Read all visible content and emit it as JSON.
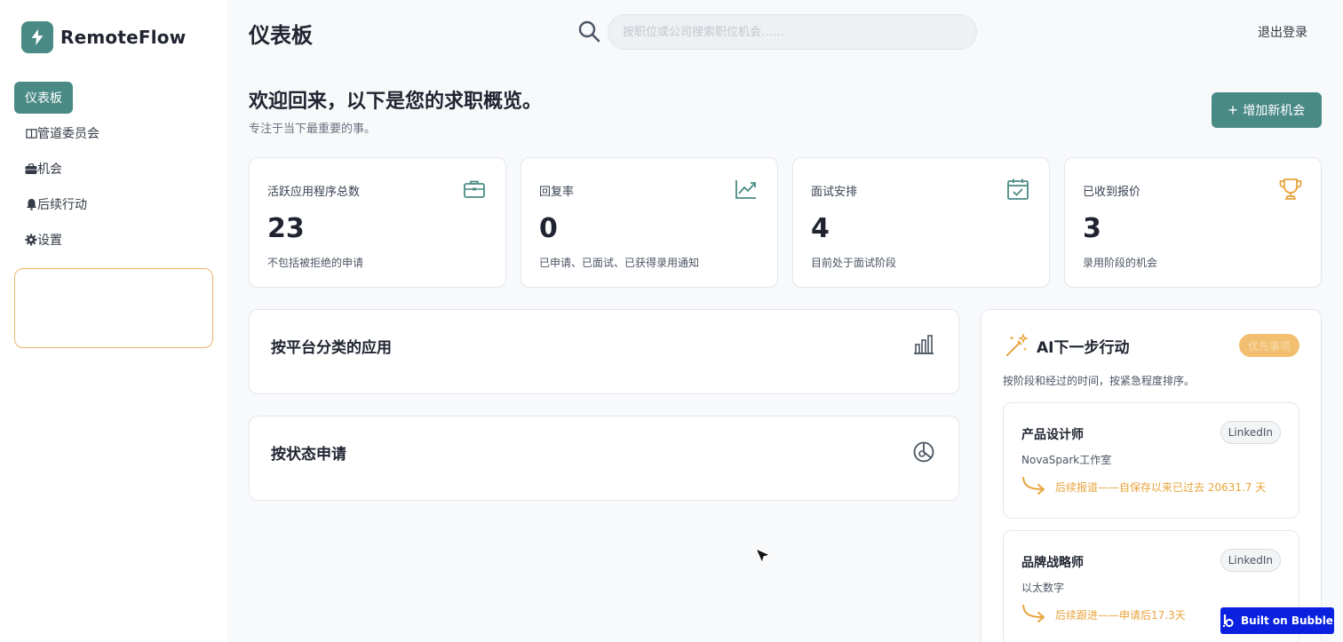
{
  "brand": {
    "name": "RemoteFlow",
    "color": "#4a8a85"
  },
  "sidebar": {
    "items": [
      {
        "label": "仪表板",
        "icon": "",
        "active": true
      },
      {
        "label": "管道委员会",
        "icon": "columns-icon"
      },
      {
        "label": "机会",
        "icon": "briefcase-icon"
      },
      {
        "label": "后续行动",
        "icon": "bell-icon"
      },
      {
        "label": "设置",
        "icon": "gear-icon"
      }
    ]
  },
  "header": {
    "title": "仪表板",
    "search_placeholder": "按职位或公司搜索职位机会……",
    "logout_label": "退出登录"
  },
  "welcome": {
    "title": "欢迎回来，以下是您的求职概览。",
    "subtitle": "专注于当下最重要的事。",
    "add_button_label": "增加新机会"
  },
  "stats": [
    {
      "label": "活跃应用程序总数",
      "value": "23",
      "desc": "不包括被拒绝的申请",
      "icon": "briefcase-icon"
    },
    {
      "label": "回复率",
      "value": "0",
      "desc": "已申请、已面试、已获得录用通知",
      "icon": "trend-chart-icon"
    },
    {
      "label": "面试安排",
      "value": "4",
      "desc": "目前处于面试阶段",
      "icon": "calendar-check-icon"
    },
    {
      "label": "已收到报价",
      "value": "3",
      "desc": "录用阶段的机会",
      "icon": "trophy-icon"
    }
  ],
  "panels": {
    "by_platform": {
      "title": "按平台分类的应用",
      "icon": "bar-chart-icon"
    },
    "by_status": {
      "title": "按状态申请",
      "icon": "pie-chart-icon"
    }
  },
  "ai": {
    "title": "AI下一步行动",
    "badge": "优先事项",
    "subtitle": "按阶段和经过的时间，按紧急程度排序。",
    "jobs": [
      {
        "title": "产品设计师",
        "platform": "LinkedIn",
        "company": "NovaSpark工作室",
        "action": "后续报道——自保存以来已过去 20631.7 天"
      },
      {
        "title": "品牌战略师",
        "platform": "LinkedIn",
        "company": "以太数字",
        "action": "后续跟进——申请后17.3天"
      }
    ]
  },
  "footer_badge": {
    "label": "Built on Bubble"
  },
  "colors": {
    "accent": "#4a8a85",
    "warning": "#e8a43c",
    "bubble_blue": "#0b21e0"
  }
}
